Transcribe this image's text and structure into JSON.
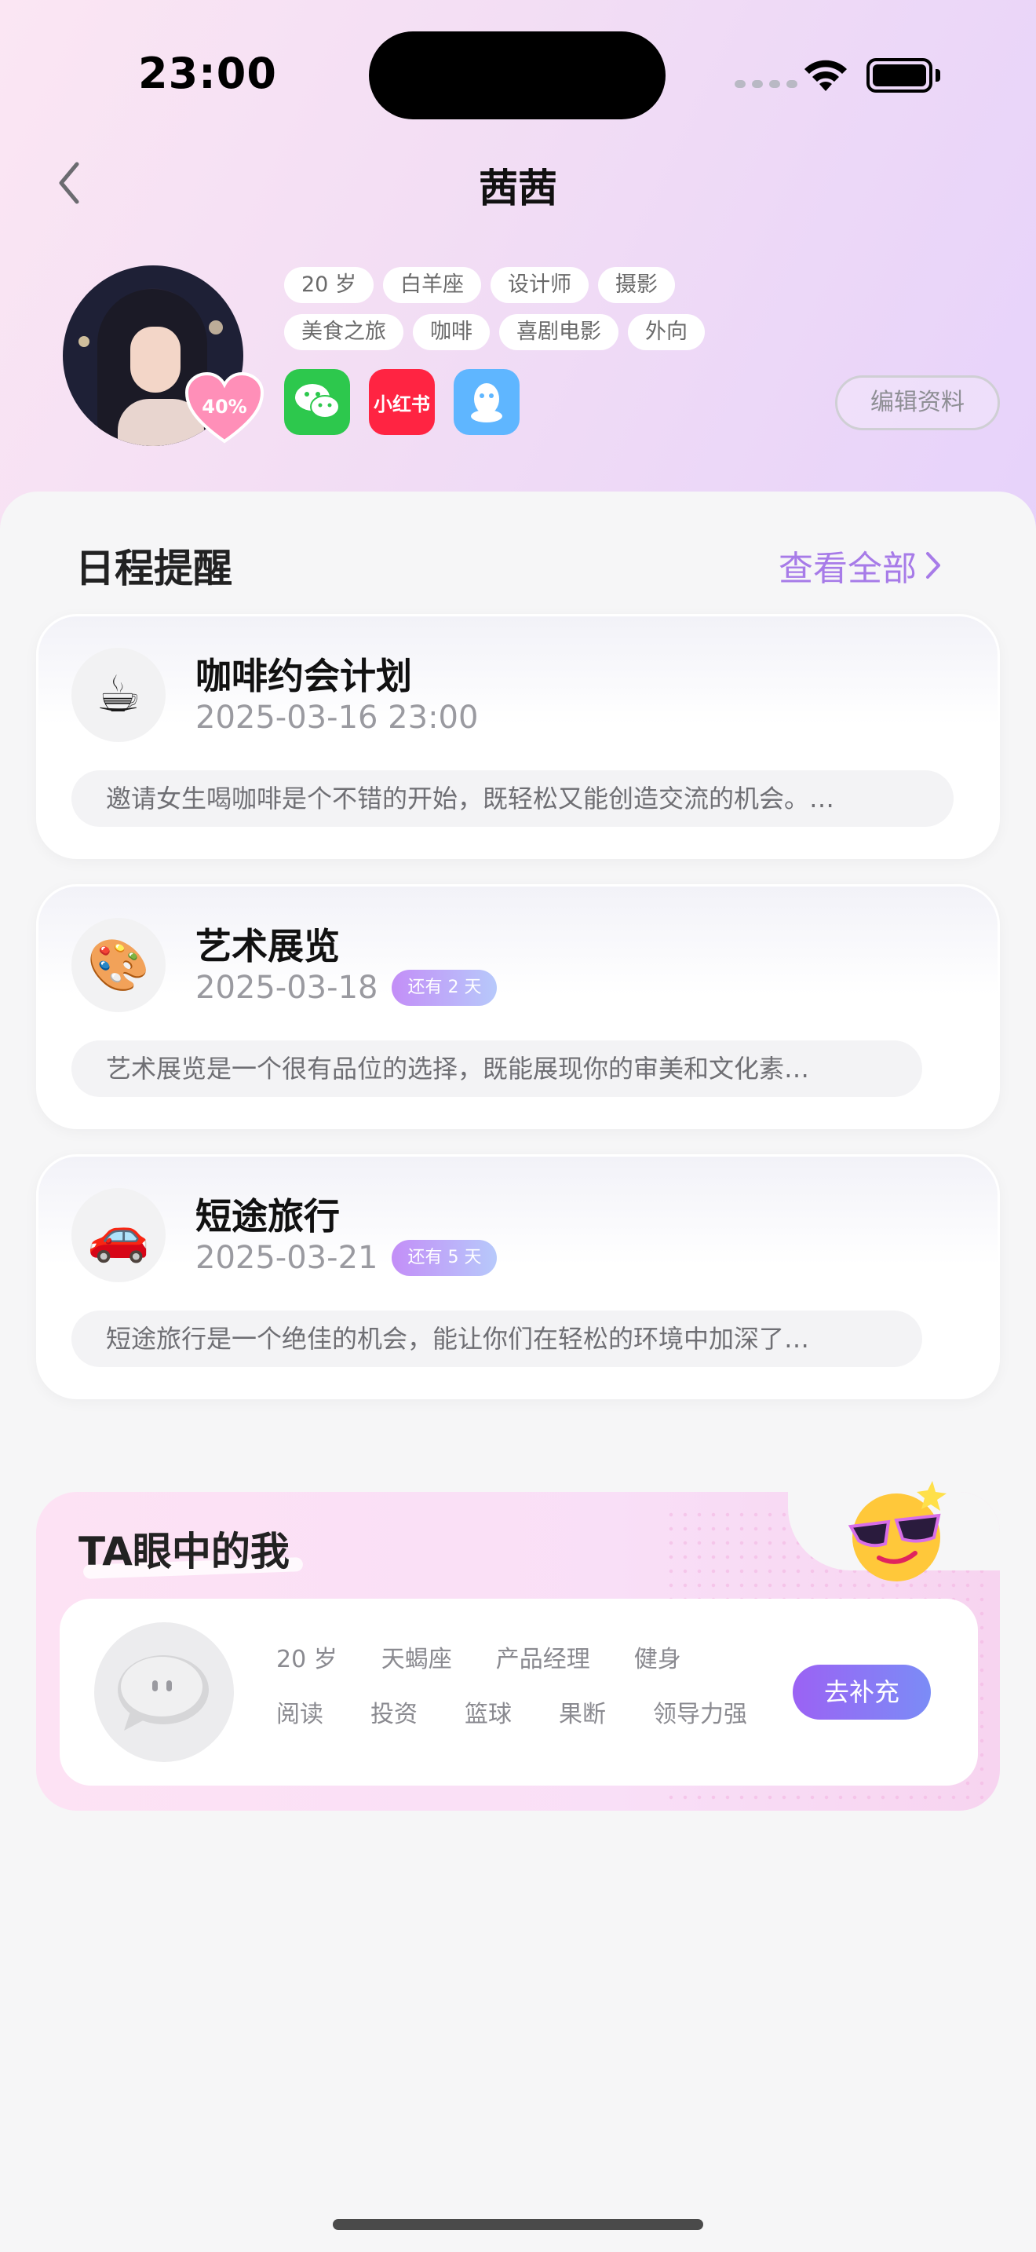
{
  "status_bar": {
    "time": "23:00"
  },
  "header": {
    "title": "茜茜"
  },
  "profile": {
    "match_percent": "40%",
    "tags_row1": [
      "20 岁",
      "白羊座",
      "设计师",
      "摄影"
    ],
    "tags_row2": [
      "美食之旅",
      "咖啡",
      "喜剧电影",
      "外向"
    ],
    "socials": [
      "wechat-icon",
      "xiaohongshu-icon",
      "qq-icon"
    ],
    "xhs_label": "小红书",
    "edit_label": "编辑资料"
  },
  "schedule": {
    "title": "日程提醒",
    "view_all": "查看全部",
    "items": [
      {
        "emoji": "☕",
        "icon": "coffee-icon",
        "title": "咖啡约会计划",
        "date": "2025-03-16 23:00",
        "badge": "",
        "desc": "邀请女生喝咖啡是个不错的开始，既轻松又能创造交流的机会。…"
      },
      {
        "emoji": "🎨",
        "icon": "palette-icon",
        "title": "艺术展览",
        "date": "2025-03-18",
        "badge": "还有 2 天",
        "desc": "艺术展览是一个很有品位的选择，既能展现你的审美和文化素…"
      },
      {
        "emoji": "🚗",
        "icon": "car-icon",
        "title": "短途旅行",
        "date": "2025-03-21",
        "badge": "还有 5 天",
        "desc": "短途旅行是一个绝佳的机会，能让你们在轻松的环境中加深了…"
      }
    ]
  },
  "ta_section": {
    "title": "TA眼中的我",
    "tags_row1": [
      "20 岁",
      "天蝎座",
      "产品经理",
      "健身"
    ],
    "tags_row2": [
      "阅读",
      "投资",
      "篮球",
      "果断",
      "领导力强"
    ],
    "fill_label": "去补充"
  },
  "colors": {
    "accent": "#a77be8",
    "wechat": "#2dc84d",
    "xhs": "#ff2442",
    "qq": "#5fb6ff"
  }
}
